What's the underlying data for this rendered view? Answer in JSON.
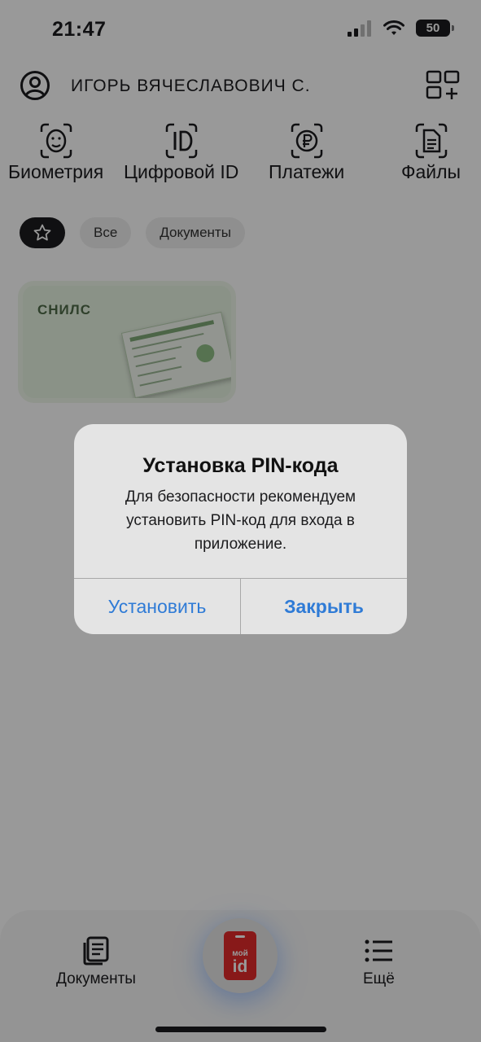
{
  "status_bar": {
    "time": "21:47",
    "battery": "50"
  },
  "header": {
    "user_name": "ИГОРЬ ВЯЧЕСЛАВОВИЧ С."
  },
  "quick_actions": [
    {
      "label": "Биометрия",
      "icon": "face-id-icon"
    },
    {
      "label": "Цифровой ID",
      "icon": "id-icon"
    },
    {
      "label": "Платежи",
      "icon": "ruble-icon"
    },
    {
      "label": "Файлы",
      "icon": "files-icon"
    }
  ],
  "filters": {
    "favorites_icon": "star-icon",
    "all": "Все",
    "documents": "Документы"
  },
  "documents": [
    {
      "title": "СНИЛС"
    }
  ],
  "alert": {
    "title": "Установка PIN-кода",
    "message": "Для безопасности рекомендуем установить PIN-код для входа в приложение.",
    "set_button": "Установить",
    "close_button": "Закрыть"
  },
  "tab_bar": {
    "documents_label": "Документы",
    "more_label": "Ещё",
    "center_logo_top": "мой",
    "center_logo_bottom": "id"
  },
  "colors": {
    "accent_blue": "#2f7bd6",
    "logo_red": "#e32b2b",
    "card_green": "#e6f3e1"
  }
}
